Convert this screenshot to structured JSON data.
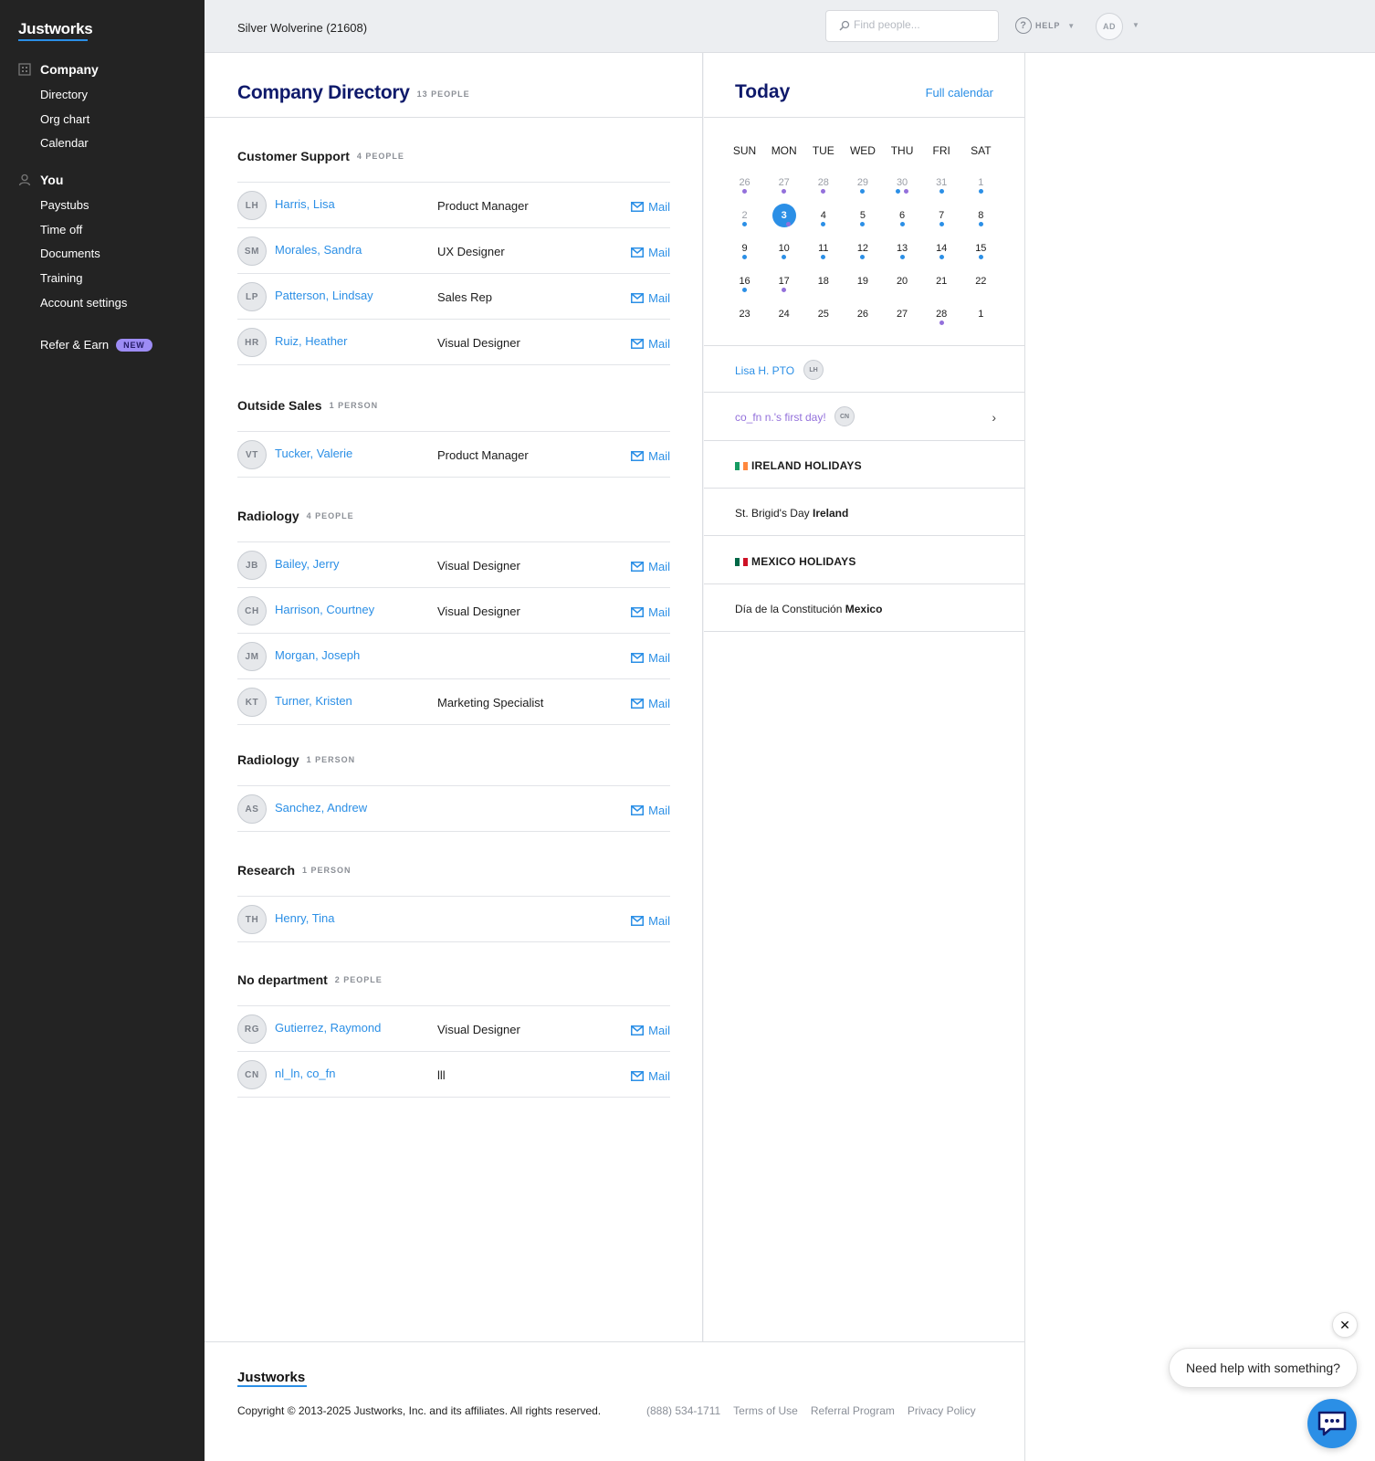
{
  "sidebar": {
    "logo": "Justworks",
    "company_section": "Company",
    "company_items": [
      "Directory",
      "Org chart",
      "Calendar"
    ],
    "you_section": "You",
    "you_items": [
      "Paystubs",
      "Time off",
      "Documents",
      "Training",
      "Account settings"
    ],
    "refer_label": "Refer & Earn",
    "refer_badge": "NEW"
  },
  "header": {
    "company_name": "Silver Wolverine (21608)",
    "search_placeholder": "Find people...",
    "help_label": "HELP",
    "user_initials": "AD"
  },
  "directory": {
    "title": "Company Directory",
    "count": "13 PEOPLE",
    "mail_label": "Mail",
    "departments": [
      {
        "name": "Customer Support",
        "count": "4 PEOPLE",
        "people": [
          {
            "initials": "LH",
            "name": "Harris, Lisa",
            "title": "Product Manager"
          },
          {
            "initials": "SM",
            "name": "Morales, Sandra",
            "title": "UX Designer"
          },
          {
            "initials": "LP",
            "name": "Patterson, Lindsay",
            "title": "Sales Rep"
          },
          {
            "initials": "HR",
            "name": "Ruiz, Heather",
            "title": "Visual Designer"
          }
        ]
      },
      {
        "name": "Outside Sales",
        "count": "1 PERSON",
        "people": [
          {
            "initials": "VT",
            "name": "Tucker, Valerie",
            "title": "Product Manager"
          }
        ]
      },
      {
        "name": "Radiology",
        "count": "4 PEOPLE",
        "people": [
          {
            "initials": "JB",
            "name": "Bailey, Jerry",
            "title": "Visual Designer"
          },
          {
            "initials": "CH",
            "name": "Harrison, Courtney",
            "title": "Visual Designer"
          },
          {
            "initials": "JM",
            "name": "Morgan, Joseph",
            "title": ""
          },
          {
            "initials": "KT",
            "name": "Turner, Kristen",
            "title": "Marketing Specialist"
          }
        ]
      },
      {
        "name": "Radiology",
        "count": "1 PERSON",
        "people": [
          {
            "initials": "AS",
            "name": "Sanchez, Andrew",
            "title": ""
          }
        ]
      },
      {
        "name": "Research",
        "count": "1 PERSON",
        "people": [
          {
            "initials": "TH",
            "name": "Henry, Tina",
            "title": ""
          }
        ]
      },
      {
        "name": "No department",
        "count": "2 PEOPLE",
        "people": [
          {
            "initials": "RG",
            "name": "Gutierrez, Raymond",
            "title": "Visual Designer"
          },
          {
            "initials": "CN",
            "name": "nl_ln, co_fn",
            "title": "lll"
          }
        ]
      }
    ]
  },
  "today": {
    "title": "Today",
    "full_calendar_link": "Full calendar",
    "weekdays": [
      "SUN",
      "MON",
      "TUE",
      "WED",
      "THU",
      "FRI",
      "SAT"
    ],
    "weeks": [
      [
        {
          "d": "26",
          "m": true,
          "dots": "p"
        },
        {
          "d": "27",
          "m": true,
          "dots": "p"
        },
        {
          "d": "28",
          "m": true,
          "dots": "p"
        },
        {
          "d": "29",
          "m": true,
          "dots": "b"
        },
        {
          "d": "30",
          "m": true,
          "dots": "bp"
        },
        {
          "d": "31",
          "m": true,
          "dots": "b"
        },
        {
          "d": "1",
          "m": true,
          "dots": "b"
        }
      ],
      [
        {
          "d": "2",
          "m": true,
          "dots": "b"
        },
        {
          "d": "3",
          "today": true,
          "dots": "bp"
        },
        {
          "d": "4",
          "dots": "b"
        },
        {
          "d": "5",
          "dots": "b"
        },
        {
          "d": "6",
          "dots": "b"
        },
        {
          "d": "7",
          "dots": "b"
        },
        {
          "d": "8",
          "dots": "b"
        }
      ],
      [
        {
          "d": "9",
          "dots": "b"
        },
        {
          "d": "10",
          "dots": "b"
        },
        {
          "d": "11",
          "dots": "b"
        },
        {
          "d": "12",
          "dots": "b"
        },
        {
          "d": "13",
          "dots": "b"
        },
        {
          "d": "14",
          "dots": "b"
        },
        {
          "d": "15",
          "dots": "b"
        }
      ],
      [
        {
          "d": "16",
          "dots": "b"
        },
        {
          "d": "17",
          "dots": "p"
        },
        {
          "d": "18",
          "dots": ""
        },
        {
          "d": "19",
          "dots": ""
        },
        {
          "d": "20",
          "dots": ""
        },
        {
          "d": "21",
          "dots": ""
        },
        {
          "d": "22",
          "dots": ""
        }
      ],
      [
        {
          "d": "23",
          "dots": ""
        },
        {
          "d": "24",
          "dots": ""
        },
        {
          "d": "25",
          "dots": ""
        },
        {
          "d": "26",
          "dots": ""
        },
        {
          "d": "27",
          "dots": ""
        },
        {
          "d": "28",
          "dots": "p"
        },
        {
          "d": "1",
          "dots": ""
        }
      ]
    ],
    "events": {
      "pto_label": "Lisa H. PTO",
      "pto_initials": "LH",
      "first_day_label": "co_fn n.'s first day!",
      "first_day_initials": "CN"
    },
    "ireland_header": "IRELAND HOLIDAYS",
    "ireland_holiday": "St. Brigid's Day",
    "ireland_country": "Ireland",
    "mexico_header": "MEXICO HOLIDAYS",
    "mexico_holiday": "Día de la Constitución",
    "mexico_country": "Mexico"
  },
  "footer": {
    "logo": "Justworks",
    "copyright": "Copyright © 2013-2025 Justworks, Inc. and its affiliates. All rights reserved.",
    "phone": "(888) 534-1711",
    "terms": "Terms of Use",
    "referral": "Referral Program",
    "privacy": "Privacy Policy"
  },
  "chat": {
    "prompt": "Need help with something?"
  },
  "colors": {
    "accent": "#2b8fe6",
    "title_navy": "#0f1a6b",
    "sidebar_bg": "#232323",
    "purple_dot": "#9370db"
  }
}
